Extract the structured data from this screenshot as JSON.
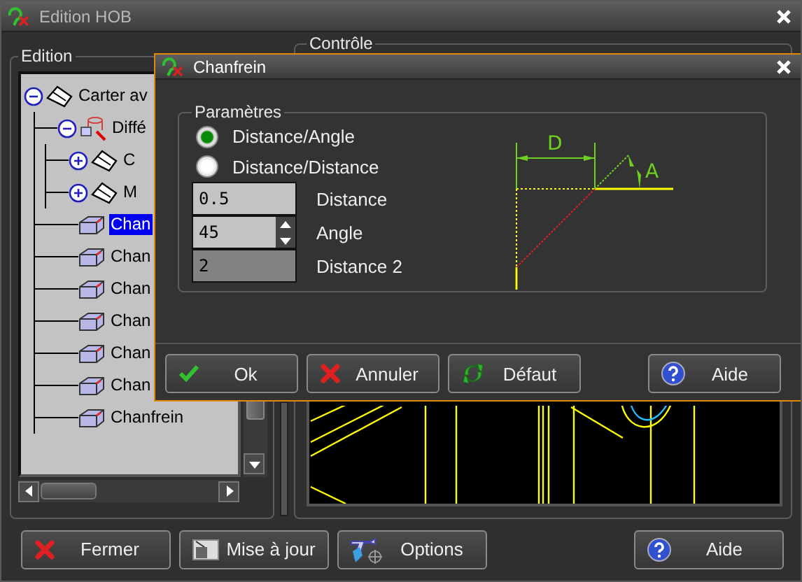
{
  "window": {
    "title": "Edition HOB"
  },
  "edition_panel": {
    "title": "Edition",
    "tree": [
      {
        "label": "Carter av",
        "kind": "part",
        "expanded": true,
        "selected": false,
        "children": [
          {
            "label": "Diffé",
            "kind": "difference",
            "expanded": true,
            "selected": false,
            "children": [
              {
                "label": "C",
                "kind": "part",
                "expanded": false,
                "selected": false
              },
              {
                "label": "M",
                "kind": "part",
                "expanded": false,
                "selected": false
              }
            ]
          },
          {
            "label": "Chan",
            "kind": "chamfer",
            "selected": true
          },
          {
            "label": "Chan",
            "kind": "chamfer",
            "selected": false
          },
          {
            "label": "Chan",
            "kind": "chamfer",
            "selected": false
          },
          {
            "label": "Chan",
            "kind": "chamfer",
            "selected": false
          },
          {
            "label": "Chan",
            "kind": "chamfer",
            "selected": false
          },
          {
            "label": "Chan",
            "kind": "chamfer",
            "selected": false
          },
          {
            "label": "Chanfrein",
            "kind": "chamfer",
            "selected": false
          }
        ]
      }
    ]
  },
  "control_panel": {
    "title": "Contrôle"
  },
  "buttons": [
    {
      "label": "Fermer",
      "kind": "close"
    },
    {
      "label": "Mise à jour",
      "kind": "update"
    },
    {
      "label": "Options",
      "kind": "options"
    },
    {
      "label": "Aide",
      "kind": "help"
    }
  ],
  "dialog": {
    "title": "Chanfrein",
    "group": "Paramètres",
    "modes": [
      {
        "label": "Distance/Angle",
        "selected": true
      },
      {
        "label": "Distance/Distance",
        "selected": false
      }
    ],
    "fields": [
      {
        "value": "0.5",
        "label": "Distance",
        "kind": "text",
        "disabled": false
      },
      {
        "value": "45",
        "label": "Angle",
        "kind": "spin",
        "disabled": false
      },
      {
        "value": "2",
        "label": "Distance 2",
        "kind": "text",
        "disabled": true
      }
    ],
    "diagram": {
      "distance_label": "D",
      "angle_label": "A"
    },
    "buttons": [
      {
        "label": "Ok",
        "kind": "ok"
      },
      {
        "label": "Annuler",
        "kind": "close"
      },
      {
        "label": "Défaut",
        "kind": "default"
      },
      {
        "label": "Aide",
        "kind": "help"
      }
    ]
  }
}
